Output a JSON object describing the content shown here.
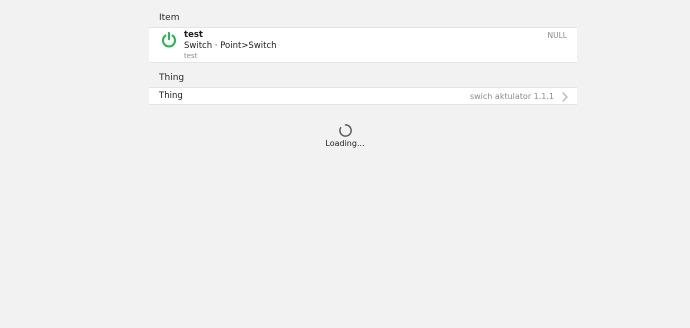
{
  "sections": {
    "item_title": "Item",
    "thing_title": "Thing"
  },
  "item": {
    "name": "test",
    "type": "Switch · Point>Switch",
    "label": "test",
    "state": "NULL",
    "icon": "power-icon",
    "icon_color": "#2ab556"
  },
  "thing": {
    "label": "Thing",
    "value": "swich aktulator 1.1.1",
    "icon": "chevron-right-icon"
  },
  "loader": {
    "text": "Loading...",
    "icon": "spinner-icon"
  }
}
